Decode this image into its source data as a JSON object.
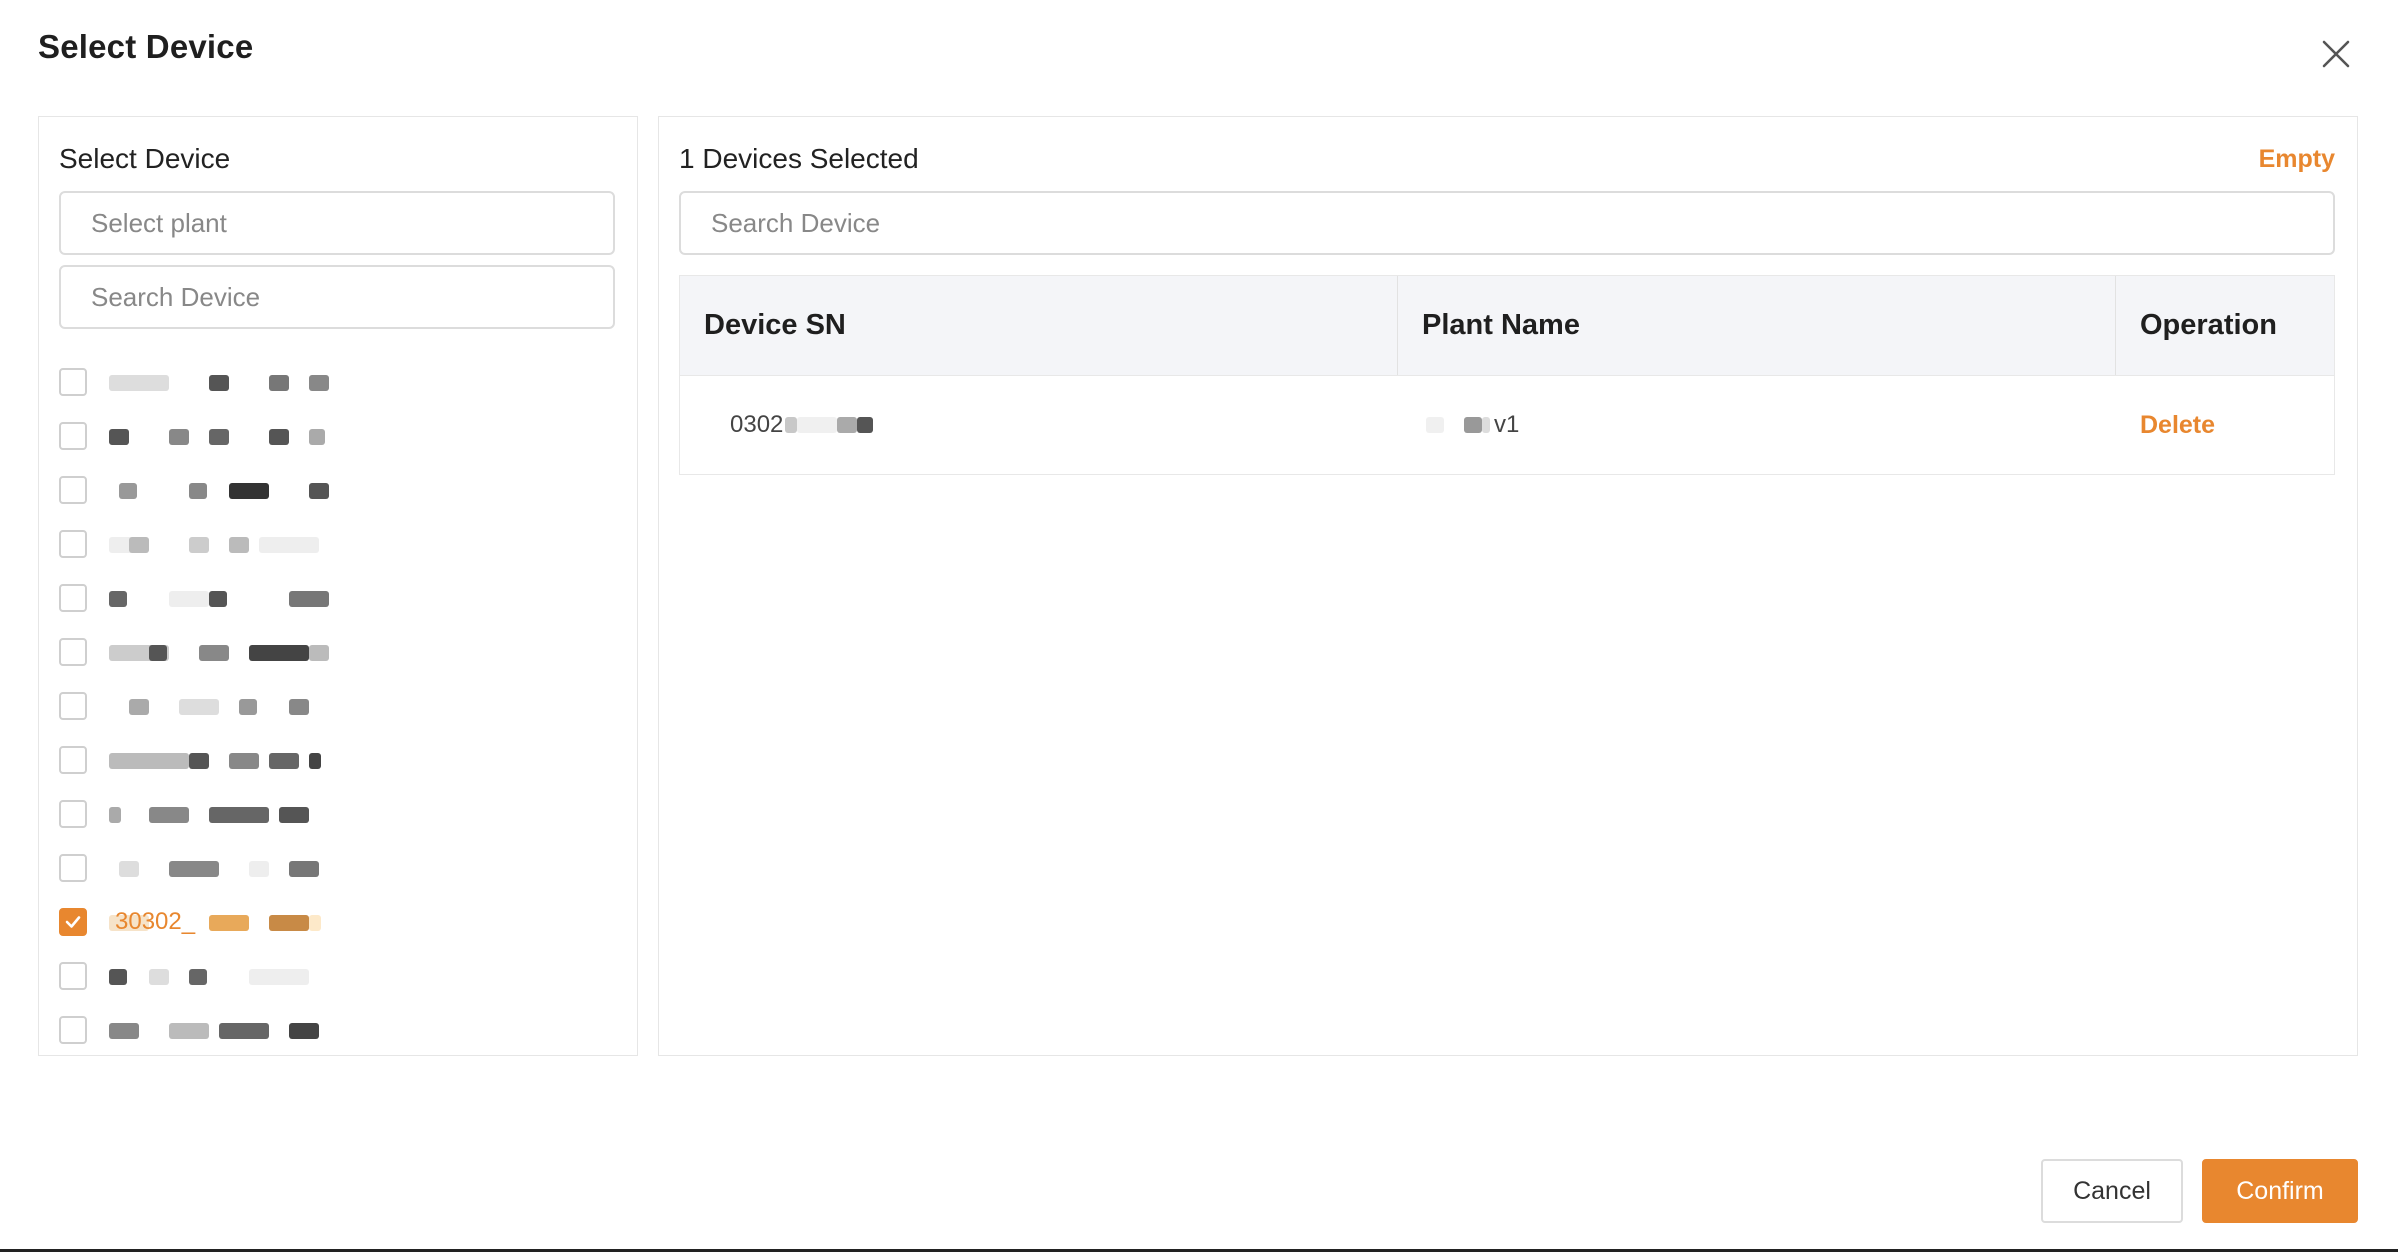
{
  "dialog": {
    "title": "Select Device",
    "close_icon": "close-icon"
  },
  "left": {
    "heading": "Select Device",
    "plant_placeholder": "Select plant",
    "search_placeholder": "Search Device",
    "devices": [
      {
        "label": "",
        "checked": false
      },
      {
        "label": "",
        "checked": false
      },
      {
        "label": "",
        "checked": false
      },
      {
        "label": "",
        "checked": false
      },
      {
        "label": "",
        "checked": false
      },
      {
        "label": "",
        "checked": false
      },
      {
        "label": "",
        "checked": false
      },
      {
        "label": "",
        "checked": false
      },
      {
        "label": "",
        "checked": false
      },
      {
        "label": "",
        "checked": false
      },
      {
        "label": "30302_",
        "checked": true
      },
      {
        "label": "",
        "checked": false
      },
      {
        "label": "",
        "checked": false
      }
    ]
  },
  "right": {
    "selected_count_text": "1 Devices Selected",
    "empty_label": "Empty",
    "search_placeholder": "Search Device",
    "table": {
      "headers": [
        "Device SN",
        "Plant Name",
        "Operation"
      ],
      "rows": [
        {
          "sn": "0302",
          "plant": "v1",
          "operation": "Delete"
        }
      ]
    }
  },
  "footer": {
    "cancel_label": "Cancel",
    "confirm_label": "Confirm"
  },
  "colors": {
    "accent": "#e8872f",
    "border": "#e6e6e6",
    "table_header_bg": "#f4f5f8"
  }
}
